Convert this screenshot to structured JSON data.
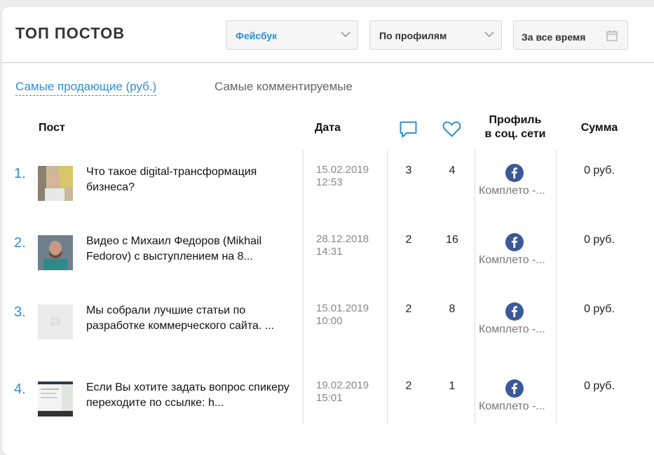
{
  "header": {
    "title": "ТОП ПОСТОВ",
    "network_select": {
      "value": "Фейсбук",
      "accent": "#2d8fd6"
    },
    "group_select": {
      "value": "По профилям"
    },
    "period_select": {
      "value": "За все время"
    }
  },
  "tabs": [
    {
      "label": "Самые продающие (руб.)",
      "active": true
    },
    {
      "label": "Самые комментируемые",
      "active": false
    }
  ],
  "table": {
    "headers": {
      "post": "Пост",
      "date": "Дата",
      "comments_icon": "comment-bubble-icon",
      "likes_icon": "heart-icon",
      "profile_line1": "Профиль",
      "profile_line2": "в соц. сети",
      "sum": "Сумма"
    },
    "rows": [
      {
        "num": "1.",
        "title": "Что такое digital-трансформация бизнеса?",
        "date": "15.02.2019",
        "time": "12:53",
        "comments": "3",
        "likes": "4",
        "profile_icon": "facebook-icon",
        "profile_name": "Комплето -...",
        "sum": "0 руб."
      },
      {
        "num": "2.",
        "title": "Видео с Михаил Федоров (Mikhail Fedorov) с выступлением на 8...",
        "date": "28.12.2018",
        "time": "14:31",
        "comments": "2",
        "likes": "16",
        "profile_icon": "facebook-icon",
        "profile_name": "Комплето -...",
        "sum": "0 руб."
      },
      {
        "num": "3.",
        "title": "Мы собрали лучшие статьи по разработке коммерческого сайта. ...",
        "date": "15.01.2019",
        "time": "10:00",
        "comments": "2",
        "likes": "8",
        "profile_icon": "facebook-icon",
        "profile_name": "Комплето -...",
        "sum": "0 руб."
      },
      {
        "num": "4.",
        "title": "Если Вы хотите задать вопрос спикеру переходите по ссылке: h...",
        "date": "19.02.2019",
        "time": "15:01",
        "comments": "2",
        "likes": "1",
        "profile_icon": "facebook-icon",
        "profile_name": "Комплето -...",
        "sum": "0 руб."
      }
    ]
  },
  "colors": {
    "accent": "#2d8fd6",
    "facebook": "#3b5998"
  }
}
